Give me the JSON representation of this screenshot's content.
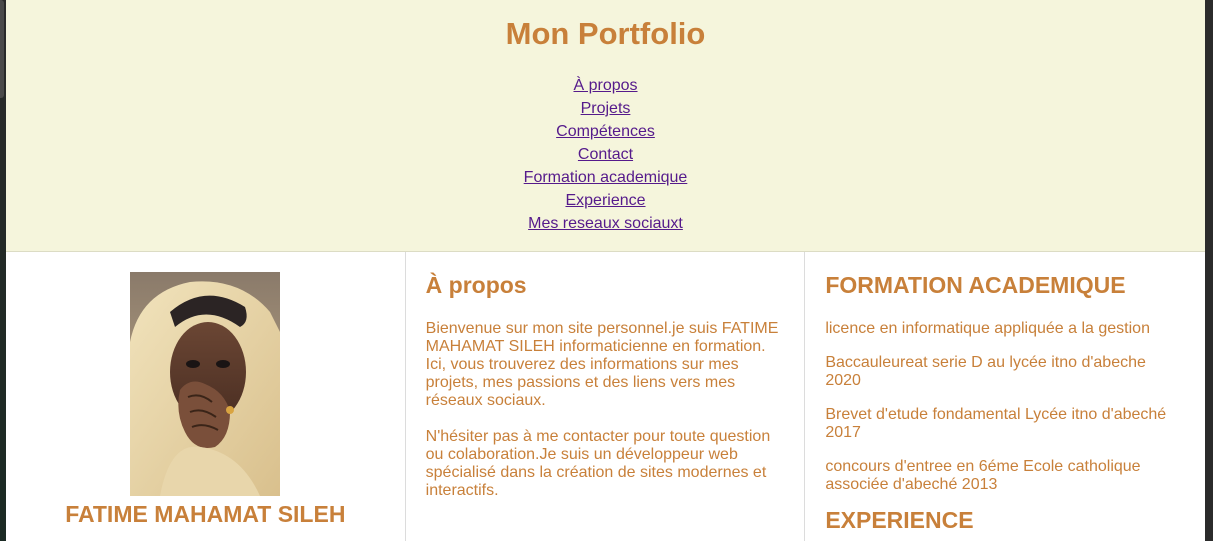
{
  "header": {
    "title": "Mon Portfolio",
    "nav": [
      "À propos",
      "Projets",
      "Compétences",
      "Contact",
      "Formation academique",
      "Experience",
      "Mes reseaux sociauxt"
    ]
  },
  "profile": {
    "name": "FATIME MAHAMAT SILEH"
  },
  "about": {
    "heading": "À propos",
    "paragraphs": [
      "Bienvenue sur mon site personnel.je suis FATIME MAHAMAT SILEH informaticienne en formation. Ici, vous trouverez des informations sur mes projets, mes passions et des liens vers mes réseaux sociaux.",
      "N'hésiter pas à me contacter pour toute question ou colaboration.Je suis un développeur web spécialisé dans la création de sites modernes et interactifs."
    ]
  },
  "formation": {
    "heading": "FORMATION ACADEMIQUE",
    "items": [
      "licence en informatique appliquée a la gestion",
      "Baccauleureat serie D au lycée itno d'abeche 2020",
      "Brevet d'etude fondamental Lycée itno d'abeché 2017",
      "concours d'entree en 6éme Ecole catholique associée d'abeché 2013"
    ]
  },
  "experience": {
    "heading": "EXPERIENCE"
  },
  "colors": {
    "accent": "#c8803a",
    "header_bg": "#f5f5dc",
    "link": "#551a8b"
  }
}
